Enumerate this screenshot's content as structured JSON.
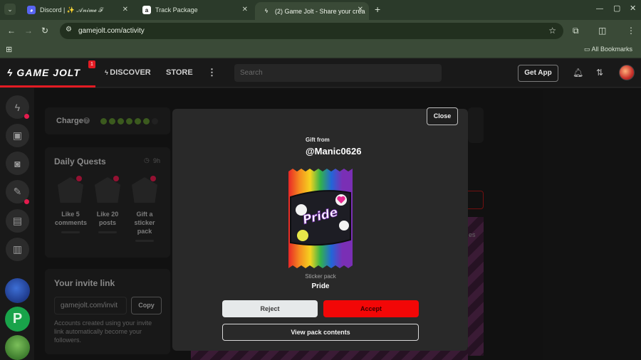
{
  "browser": {
    "tabs": [
      {
        "title": "Discord | ✨ 𝒜𝓃𝒾𝓂ℯ ℱ",
        "favicon": "discord-icon"
      },
      {
        "title": "Track Package",
        "favicon": "amazon-icon"
      },
      {
        "title": "(2) Game Jolt - Share your crea",
        "favicon": "gamejolt-icon",
        "active": true
      }
    ],
    "new_tab_symbol": "+",
    "url": "gamejolt.com/activity",
    "bookmarks_label": "All Bookmarks",
    "window_controls": [
      "—",
      "▢",
      "✕"
    ]
  },
  "site": {
    "logo": "GAME JOLT",
    "logo_badge": "1",
    "nav": {
      "discover": "DISCOVER",
      "store": "STORE",
      "more": "⋮"
    },
    "search_placeholder": "Search",
    "get_app": "Get App"
  },
  "sidebar_left": {
    "charge_label": "Charge",
    "charge_help": "?",
    "daily_quests_title": "Daily Quests",
    "daily_quests_timer": "9h",
    "quests": [
      {
        "label": "Like 5 comments"
      },
      {
        "label": "Like 20 posts"
      },
      {
        "label": "Gift a sticker pack"
      }
    ],
    "invite_title": "Your invite link",
    "invite_value": "gamejolt.com/invit",
    "copy_label": "Copy",
    "invite_desc": "Accounts created using your invite link automatically become your followers."
  },
  "background_partial": {
    "right_fragment": "es"
  },
  "modal": {
    "close_label": "Close",
    "gift_from_label": "Gift from",
    "gift_user": "@Manic0626",
    "pack_logo_text": "Pride",
    "pack_kind": "Sticker pack",
    "pack_name": "Pride",
    "reject_label": "Reject",
    "accept_label": "Accept",
    "view_label": "View pack contents"
  },
  "colors": {
    "accent_red": "#f20707",
    "browser_frame": "#3a4a37",
    "modal_bg": "#292929",
    "charge_orb": "#5b8a2e"
  }
}
